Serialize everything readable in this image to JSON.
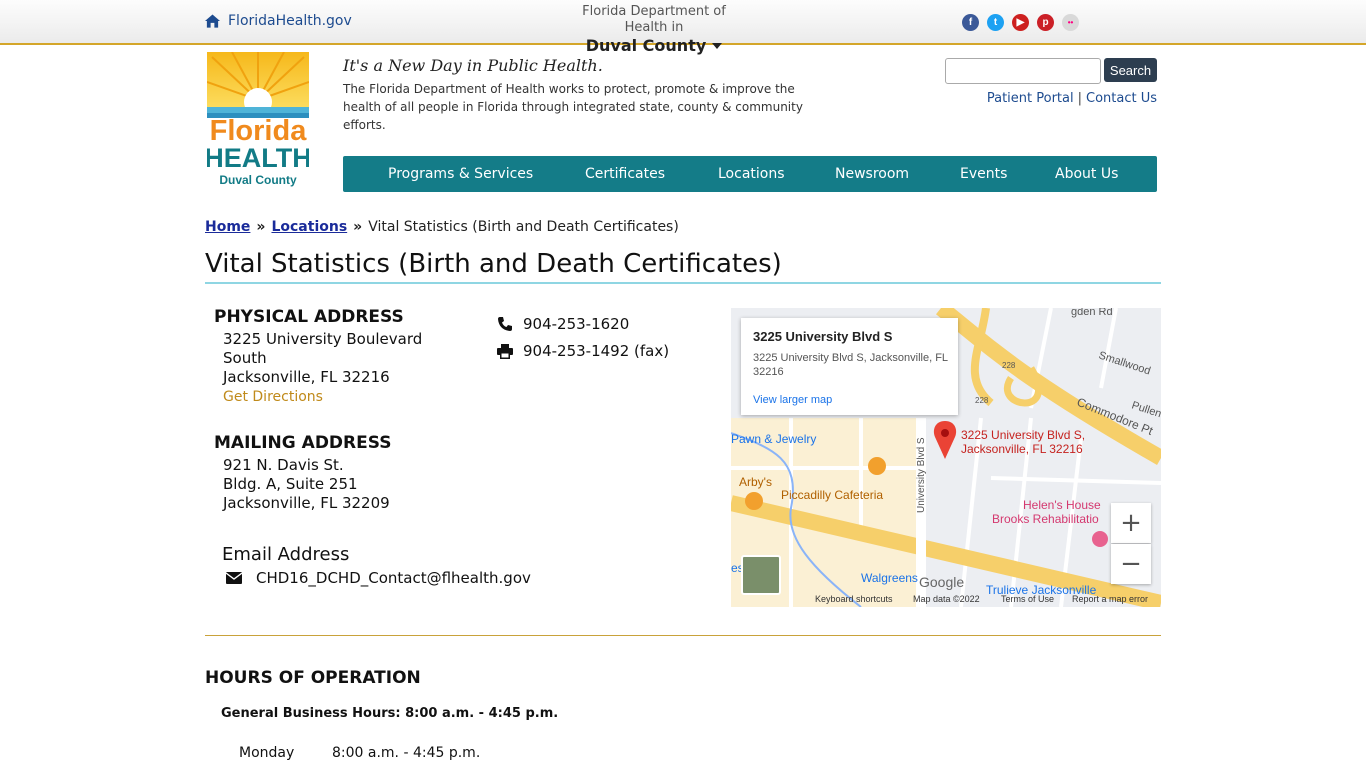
{
  "topbar": {
    "home_link": "FloridaHealth.gov",
    "county_pre": "Florida Department of Health in",
    "county_name": "Duval County",
    "social": [
      {
        "name": "facebook-icon",
        "color": "#3b5998",
        "glyph": "f"
      },
      {
        "name": "twitter-icon",
        "color": "#1da1f2",
        "glyph": "t"
      },
      {
        "name": "youtube-icon",
        "color": "#cd201f",
        "glyph": "▶"
      },
      {
        "name": "pinterest-icon",
        "color": "#cb2027",
        "glyph": "p"
      },
      {
        "name": "flickr-icon",
        "color": "#d9d9d9",
        "glyph": "••"
      }
    ]
  },
  "logo": {
    "line1": "Florida",
    "line2": "HEALTH",
    "line3": "Duval County"
  },
  "header": {
    "tagline": "It's a New Day in Public Health.",
    "mission": "The Florida Department of Health works to protect, promote & improve the health of all people in Florida through integrated state, county & community efforts.",
    "search_button": "Search",
    "search_placeholder": "",
    "patient_portal": "Patient Portal",
    "separator": "|",
    "contact_us": "Contact Us"
  },
  "nav": {
    "items": [
      "Programs & Services",
      "Certificates",
      "Locations",
      "Newsroom",
      "Events",
      "About Us"
    ]
  },
  "breadcrumb": {
    "home": "Home",
    "locations": "Locations",
    "current": "Vital Statistics (Birth and Death Certificates)",
    "sep": "»"
  },
  "page": {
    "title": "Vital Statistics (Birth and Death Certificates)"
  },
  "physical": {
    "heading": "PHYSICAL ADDRESS",
    "lines": [
      "3225 University Boulevard",
      "South",
      "Jacksonville, FL 32216"
    ],
    "directions": "Get Directions"
  },
  "mailing": {
    "heading": "MAILING ADDRESS",
    "lines": [
      "921 N. Davis St.",
      "Bldg. A, Suite 251",
      "Jacksonville, FL 32209"
    ]
  },
  "email": {
    "heading": "Email Address",
    "address": "CHD16_DCHD_Contact@flhealth.gov"
  },
  "phones": {
    "phone": "904-253-1620",
    "fax": "904-253-1492 (fax)"
  },
  "map": {
    "card_title": "3225 University Blvd S",
    "card_addr": "3225 University Blvd S, Jacksonville, FL 32216",
    "card_link": "View larger map",
    "pin_label_1": "3225 University Blvd S,",
    "pin_label_2": "Jacksonville, FL 32216",
    "labels": {
      "road_1": "Commodore Pt",
      "road_2": "Smallwood",
      "road_3": "Pullen",
      "road_4": "gden Rd",
      "road_5": "University Blvd S",
      "shield_1": "228",
      "shield_2": "228",
      "poi_1": "Pawn & Jewelry",
      "poi_2": "Arby's",
      "poi_3": "Piccadilly Cafeteria",
      "poi_4": "Helen's House",
      "poi_5": "Brooks Rehabilitatio",
      "poi_6": "Walgreens",
      "poi_7": "Trulieve Jacksonville",
      "edge_1": "es",
      "google": "Google"
    },
    "zoom_in": "+",
    "zoom_out": "−",
    "footer": [
      "Keyboard shortcuts",
      "Map data ©2022",
      "Terms of Use",
      "Report a map error"
    ]
  },
  "hours": {
    "heading": "HOURS OF OPERATION",
    "general": "General Business Hours: 8:00 a.m. - 4:45 p.m.",
    "day": "Monday",
    "time": "8:00 a.m. - 4:45 p.m."
  }
}
